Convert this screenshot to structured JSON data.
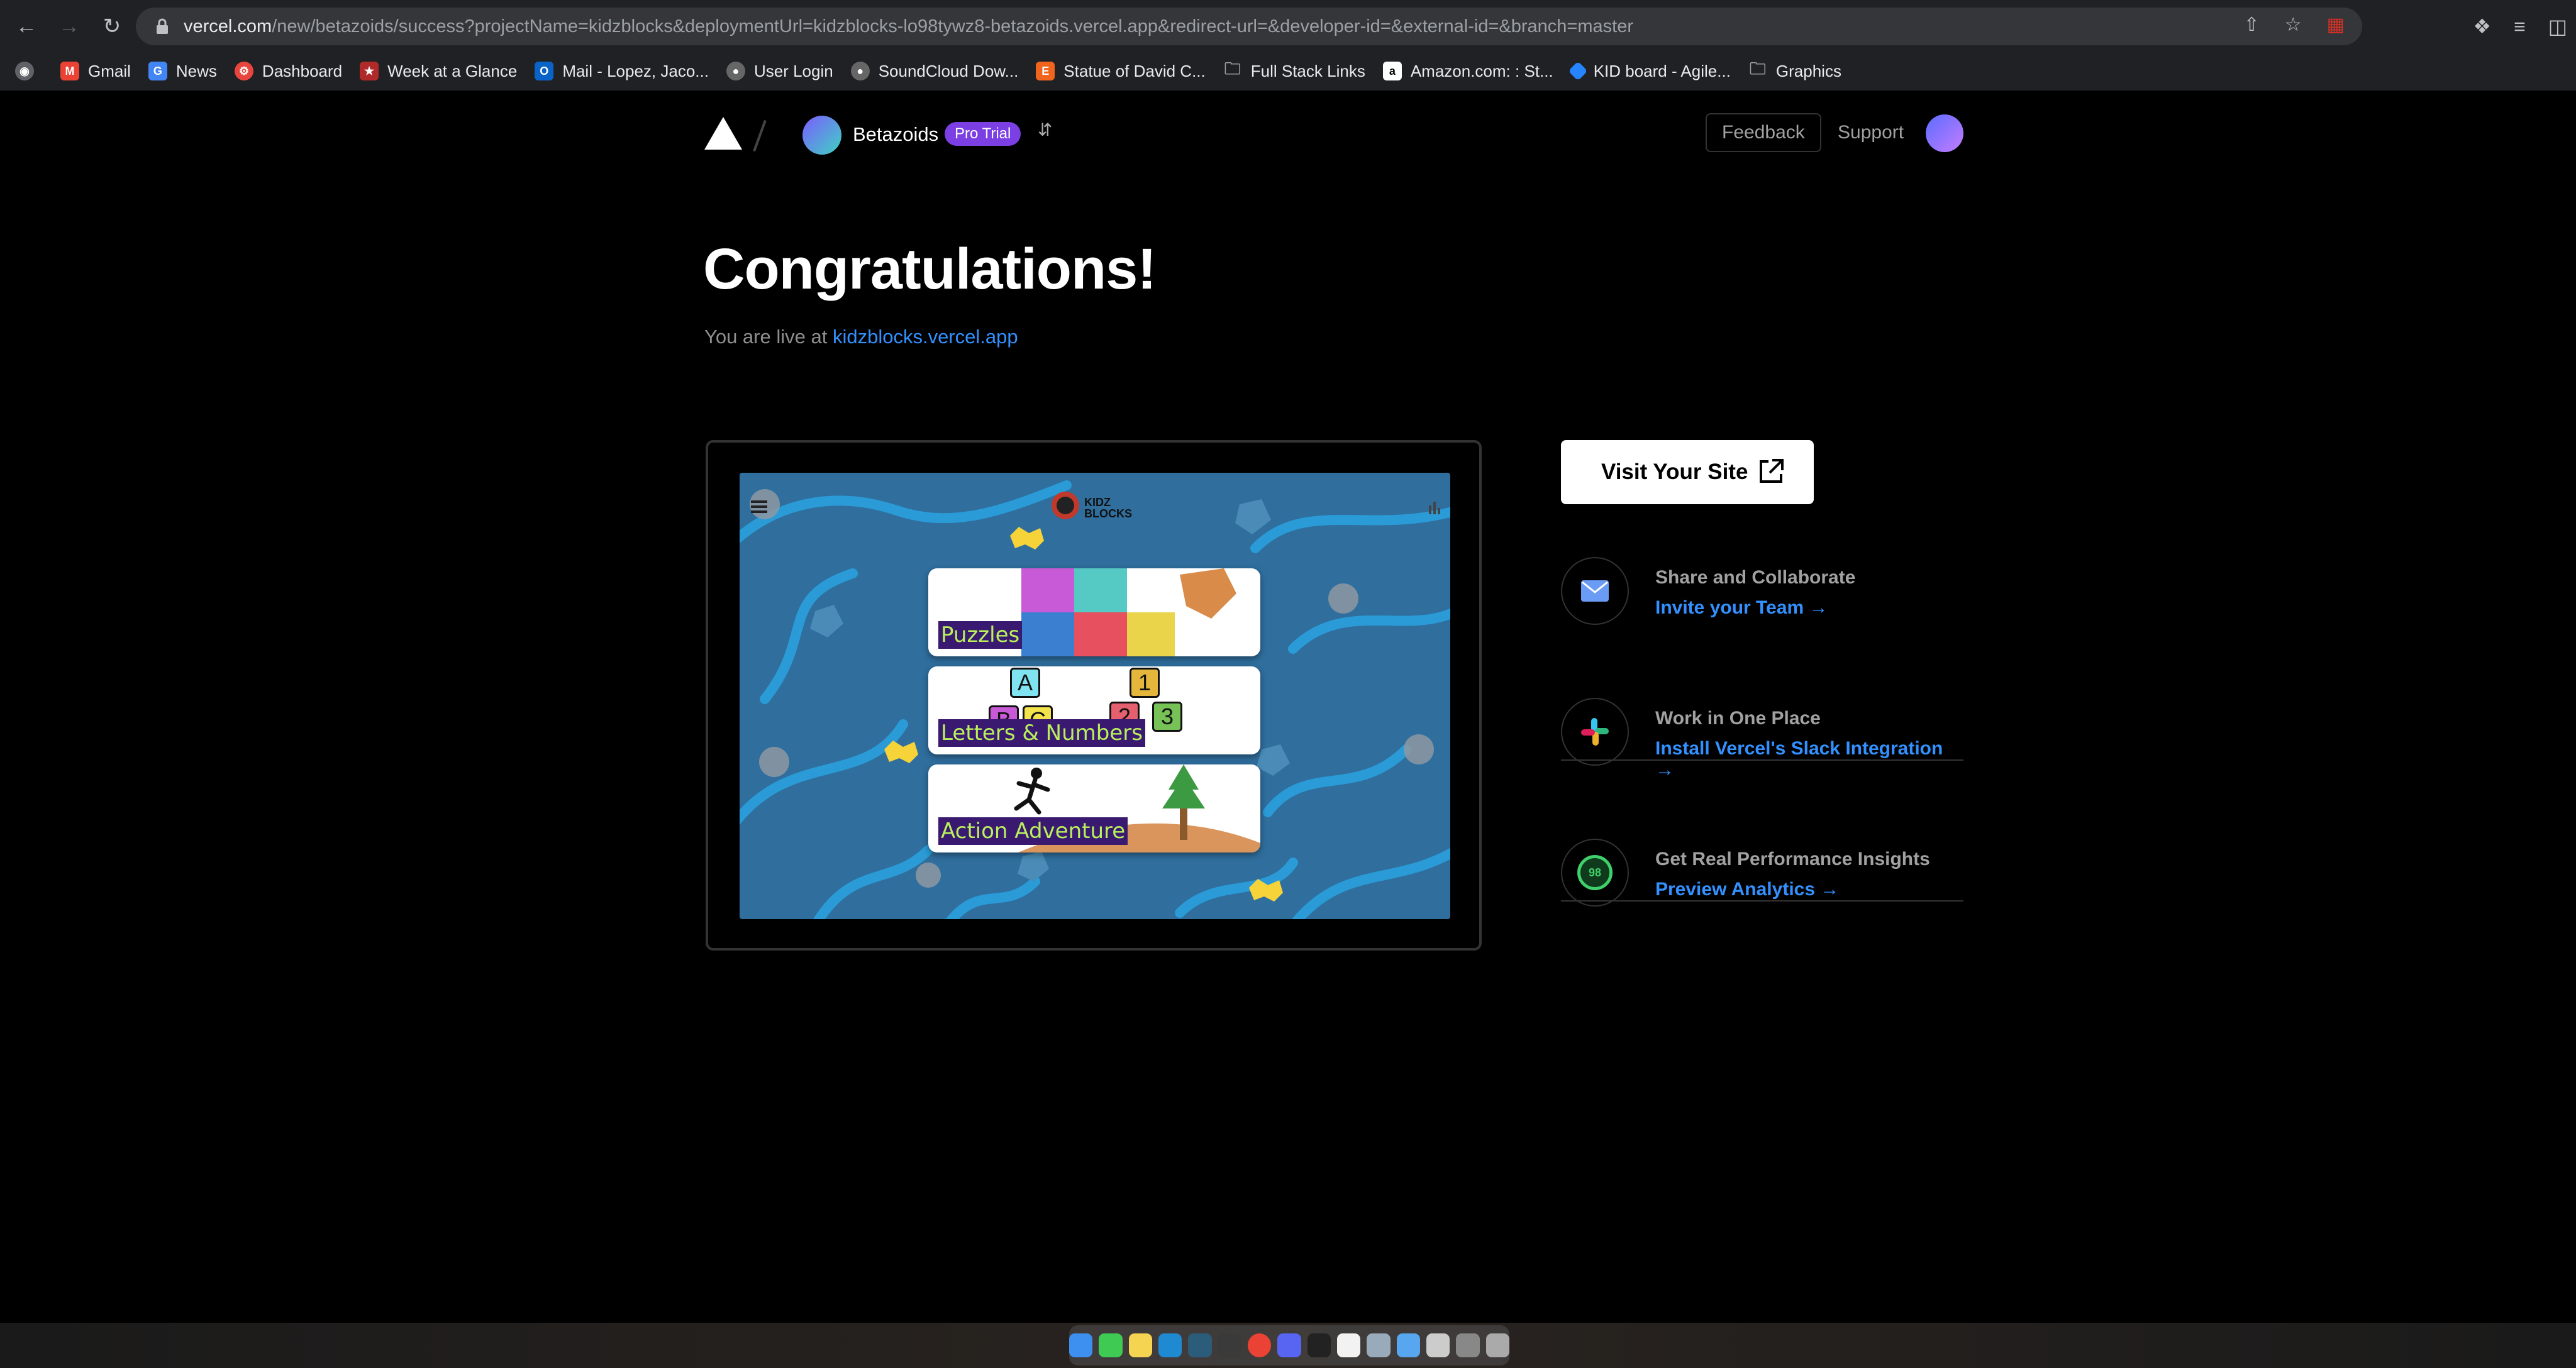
{
  "browser": {
    "url_host": "vercel.com",
    "url_rest": "/new/betazoids/success?projectName=kidzblocks&deploymentUrl=kidzblocks-lo98tywz8-betazoids.vercel.app&redirect-url=&developer-id=&external-id=&branch=master",
    "bookmarks": [
      {
        "label": "Gmail",
        "icon": "gmail-icon",
        "color": "#ea4335"
      },
      {
        "label": "News",
        "icon": "news-icon",
        "color": "#4285f4"
      },
      {
        "label": "Dashboard",
        "icon": "dashboard-icon",
        "color": "#e8453c"
      },
      {
        "label": "Week at a Glance",
        "icon": "star-icon",
        "color": "#b02a2a"
      },
      {
        "label": "Mail - Lopez, Jaco...",
        "icon": "outlook-icon",
        "color": "#0a64c8"
      },
      {
        "label": "User Login",
        "icon": "globe-icon",
        "color": "#666666"
      },
      {
        "label": "SoundCloud Dow...",
        "icon": "globe-icon",
        "color": "#666666"
      },
      {
        "label": "Statue of David C...",
        "icon": "etsy-icon",
        "color": "#f1641e"
      },
      {
        "label": "Full Stack Links",
        "icon": "folder-icon",
        "color": "#9aa0a6"
      },
      {
        "label": "Amazon.com: : St...",
        "icon": "amazon-icon",
        "color": "#ffffff"
      },
      {
        "label": "KID board - Agile...",
        "icon": "jira-icon",
        "color": "#2684ff"
      },
      {
        "label": "Graphics",
        "icon": "folder-icon",
        "color": "#9aa0a6"
      }
    ]
  },
  "header": {
    "team_name": "Betazoids",
    "plan_badge": "Pro Trial",
    "feedback": "Feedback",
    "support": "Support"
  },
  "main": {
    "heading": "Congratulations!",
    "live_prefix": "You are live at",
    "live_link": "kidzblocks.vercel.app"
  },
  "preview": {
    "cards": [
      "Puzzles",
      "Letters & Numbers",
      "Action Adventure"
    ],
    "logo_text": "KIDZ BLOCKS",
    "letters": [
      "A",
      "B",
      "C"
    ],
    "numbers": [
      "1",
      "2",
      "3"
    ]
  },
  "sidebar": {
    "visit_button": "Visit Your Site",
    "actions": [
      {
        "title": "Share and Collaborate",
        "link": "Invite your Team →",
        "icon": "mail-icon"
      },
      {
        "title": "Work in One Place",
        "link": "Install Vercel's Slack Integration →",
        "icon": "slack-icon"
      },
      {
        "title": "Get Real Performance Insights",
        "link": "Preview Analytics →",
        "icon": "analytics-score-icon",
        "score": "98"
      }
    ]
  },
  "colors": {
    "accent": "#3291ff",
    "badge": "#7b3fe4",
    "background": "#000000"
  }
}
